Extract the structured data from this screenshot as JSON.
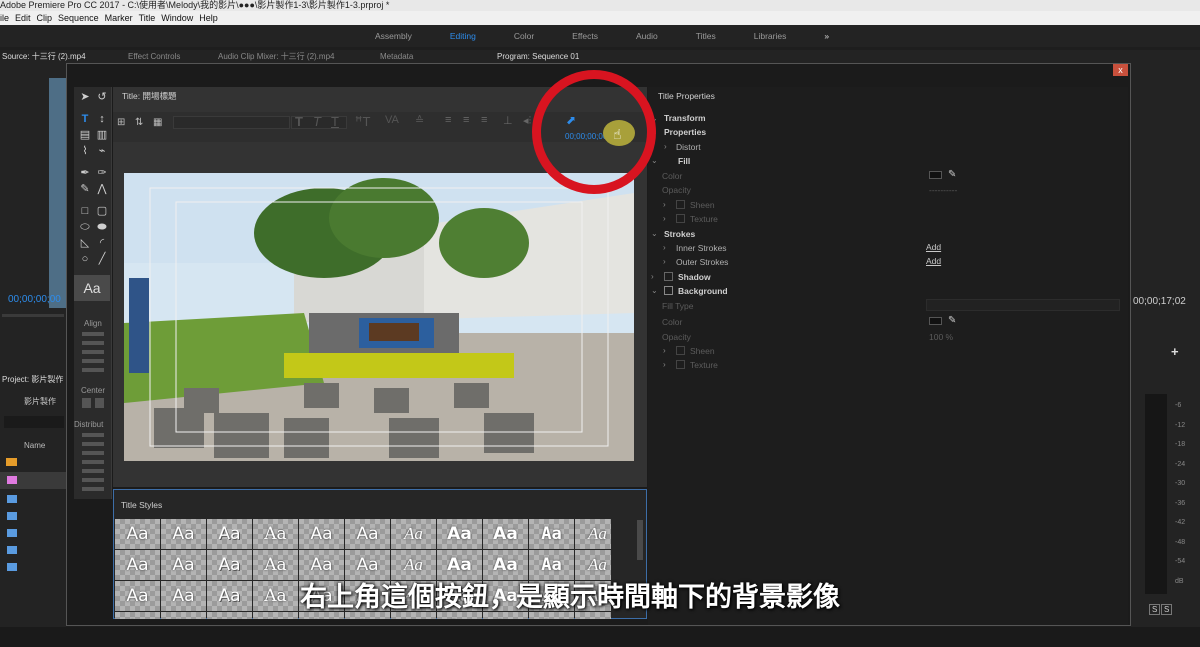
{
  "window": {
    "title": "Adobe Premiere Pro CC 2017 - C:\\使用者\\Melody\\我的影片\\●●●\\影片製作1-3\\影片製作1-3.prproj *"
  },
  "menu": [
    "ile",
    "Edit",
    "Clip",
    "Sequence",
    "Marker",
    "Title",
    "Window",
    "Help"
  ],
  "workspaces": [
    {
      "label": "Assembly",
      "active": false
    },
    {
      "label": "Editing",
      "active": true
    },
    {
      "label": "Color",
      "active": false
    },
    {
      "label": "Effects",
      "active": false
    },
    {
      "label": "Audio",
      "active": false
    },
    {
      "label": "Titles",
      "active": false
    },
    {
      "label": "Libraries",
      "active": false
    }
  ],
  "workspaces_more": "»",
  "background_panels": {
    "source_tab": "Source: 十三行 (2).mp4",
    "effect_controls_tab": "Effect Controls",
    "audio_mixer_tab": "Audio Clip Mixer: 十三行 (2).mp4",
    "metadata_tab": "Metadata",
    "program_tab": "Program: Sequence 01",
    "source_timecode": "00;00;00;00",
    "program_timecode": "00;00;17;02",
    "project_tab": "Project: 影片製作",
    "project_item": "影片製作",
    "name_column": "Name",
    "add_icon": "+",
    "meter_labels": [
      "-6",
      "-12",
      "-18",
      "-24",
      "-30",
      "-36",
      "-42",
      "-48",
      "-54",
      "dB"
    ],
    "solo_buttons": [
      "S",
      "S"
    ]
  },
  "dialog": {
    "close_label": "x",
    "title_tab": "Title: 開場標題",
    "timecode": "00;00;00;00",
    "align_label": "Align",
    "center_label": "Center",
    "distribute_label": "Distribut",
    "styles_tab": "Title Styles",
    "style_sample": "Aa",
    "properties_tab": "Title Properties",
    "properties": {
      "transform": "Transform",
      "properties": "Properties",
      "distort": "Distort",
      "fill": "Fill",
      "color": "Color",
      "opacity": "Opacity",
      "opacity_value": "----------",
      "sheen": "Sheen",
      "texture": "Texture",
      "strokes": "Strokes",
      "inner_strokes": "Inner Strokes",
      "outer_strokes": "Outer Strokes",
      "add": "Add",
      "shadow": "Shadow",
      "background": "Background",
      "fill_type": "Fill Type",
      "bg_color": "Color",
      "bg_opacity": "Opacity",
      "bg_opacity_value": "100 %",
      "bg_sheen": "Sheen",
      "bg_texture": "Texture"
    }
  },
  "subtitle": "右上角這個按鈕，是顯示時間軸下的背景影像",
  "colors": {
    "accent_blue": "#2d8ceb",
    "highlight_red": "#d81420"
  }
}
